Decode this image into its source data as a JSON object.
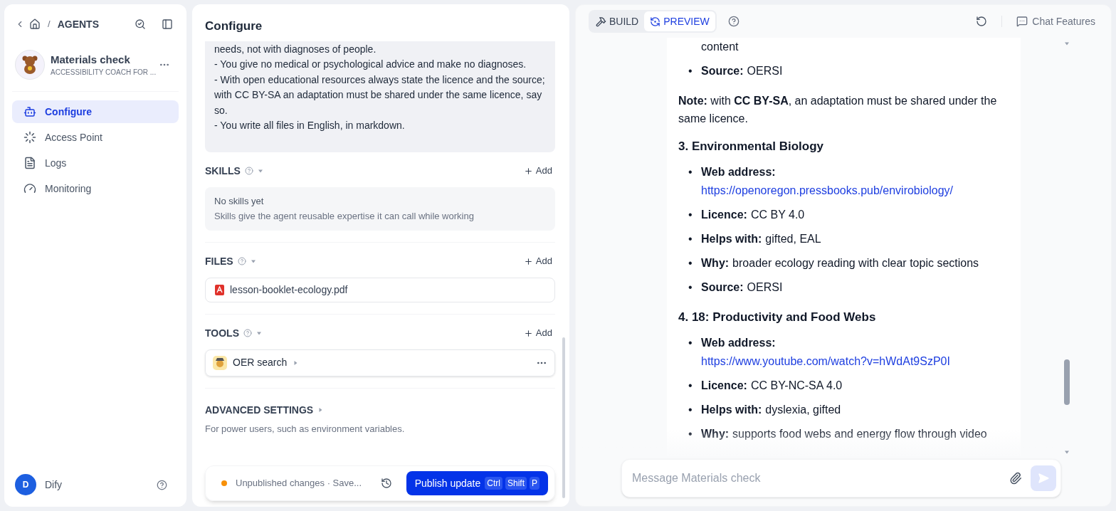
{
  "breadcrumb": {
    "separator": "/",
    "section": "AGENTS"
  },
  "agent": {
    "name": "Materials check",
    "subtitle": "ACCESSIBILITY COACH FOR ..."
  },
  "nav": [
    {
      "label": "Configure",
      "kind": "configure",
      "selected": true
    },
    {
      "label": "Access Point",
      "kind": "access",
      "selected": false
    },
    {
      "label": "Logs",
      "kind": "logs",
      "selected": false
    },
    {
      "label": "Monitoring",
      "kind": "monitoring",
      "selected": false
    }
  ],
  "user": {
    "initial": "D",
    "name": "Dify"
  },
  "configure": {
    "title": "Configure",
    "instructions": [
      "needs, not with diagnoses of people.",
      "- You give no medical or psychological advice and make no diagnoses.",
      "- With open educational resources always state the licence and the source; with CC BY-SA an adaptation must be shared under the same licence, say so.",
      "- You write all files in English, in markdown."
    ],
    "skills": {
      "title": "SKILLS",
      "add": "Add",
      "empty_title": "No skills yet",
      "empty_text": "Skills give the agent reusable expertise it can call while working"
    },
    "files": {
      "title": "FILES",
      "add": "Add",
      "items": [
        "lesson-booklet-ecology.pdf"
      ]
    },
    "tools": {
      "title": "TOOLS",
      "add": "Add",
      "items": [
        "OER search"
      ]
    },
    "advanced": {
      "title": "ADVANCED SETTINGS",
      "description": "For power users, such as environment variables."
    },
    "publish": {
      "status": "Unpublished changes · Save...",
      "button": "Publish update",
      "keys": [
        "Ctrl",
        "Shift",
        "P"
      ]
    }
  },
  "preview": {
    "tabs": [
      {
        "label": "BUILD",
        "kind": "build",
        "selected": false
      },
      {
        "label": "PREVIEW",
        "kind": "preview",
        "selected": true
      }
    ],
    "chat_features": "Chat Features",
    "message": [
      {
        "kind": "fragment",
        "text": "content"
      },
      {
        "kind": "list",
        "items": [
          {
            "bullet": "•",
            "label": "Source:",
            "value": "OERSI",
            "link": false
          }
        ]
      },
      {
        "kind": "paragraph",
        "text": "**Note:** with **CC BY-SA**, an adaptation must be shared under the same licence."
      },
      {
        "kind": "heading",
        "text": "3. Environmental Biology"
      },
      {
        "kind": "list",
        "items": [
          {
            "bullet": "•",
            "label": "Web address:",
            "value": "https://openoregon.pressbooks.pub/envirobiology/",
            "link": true
          },
          {
            "bullet": "•",
            "label": "Licence:",
            "value": "CC BY 4.0",
            "link": false
          },
          {
            "bullet": "•",
            "label": "Helps with:",
            "value": "gifted, EAL",
            "link": false
          },
          {
            "bullet": "•",
            "label": "Why:",
            "value": "broader ecology reading with clear topic sections",
            "link": false
          },
          {
            "bullet": "•",
            "label": "Source:",
            "value": "OERSI",
            "link": false
          }
        ]
      },
      {
        "kind": "heading",
        "text": "4. 18: Productivity and Food Webs"
      },
      {
        "kind": "list",
        "items": [
          {
            "bullet": "•",
            "label": "Web address:",
            "value": "https://www.youtube.com/watch?v=hWdAt9SzP0I",
            "link": true
          },
          {
            "bullet": "•",
            "label": "Licence:",
            "value": "CC BY-NC-SA 4.0",
            "link": false
          },
          {
            "bullet": "•",
            "label": "Helps with:",
            "value": "dyslexia, gifted",
            "link": false
          },
          {
            "bullet": "•",
            "label": "Why:",
            "value": "supports food webs and energy flow through video",
            "link": false
          }
        ]
      }
    ],
    "input": {
      "placeholder": "Message Materials check"
    }
  }
}
